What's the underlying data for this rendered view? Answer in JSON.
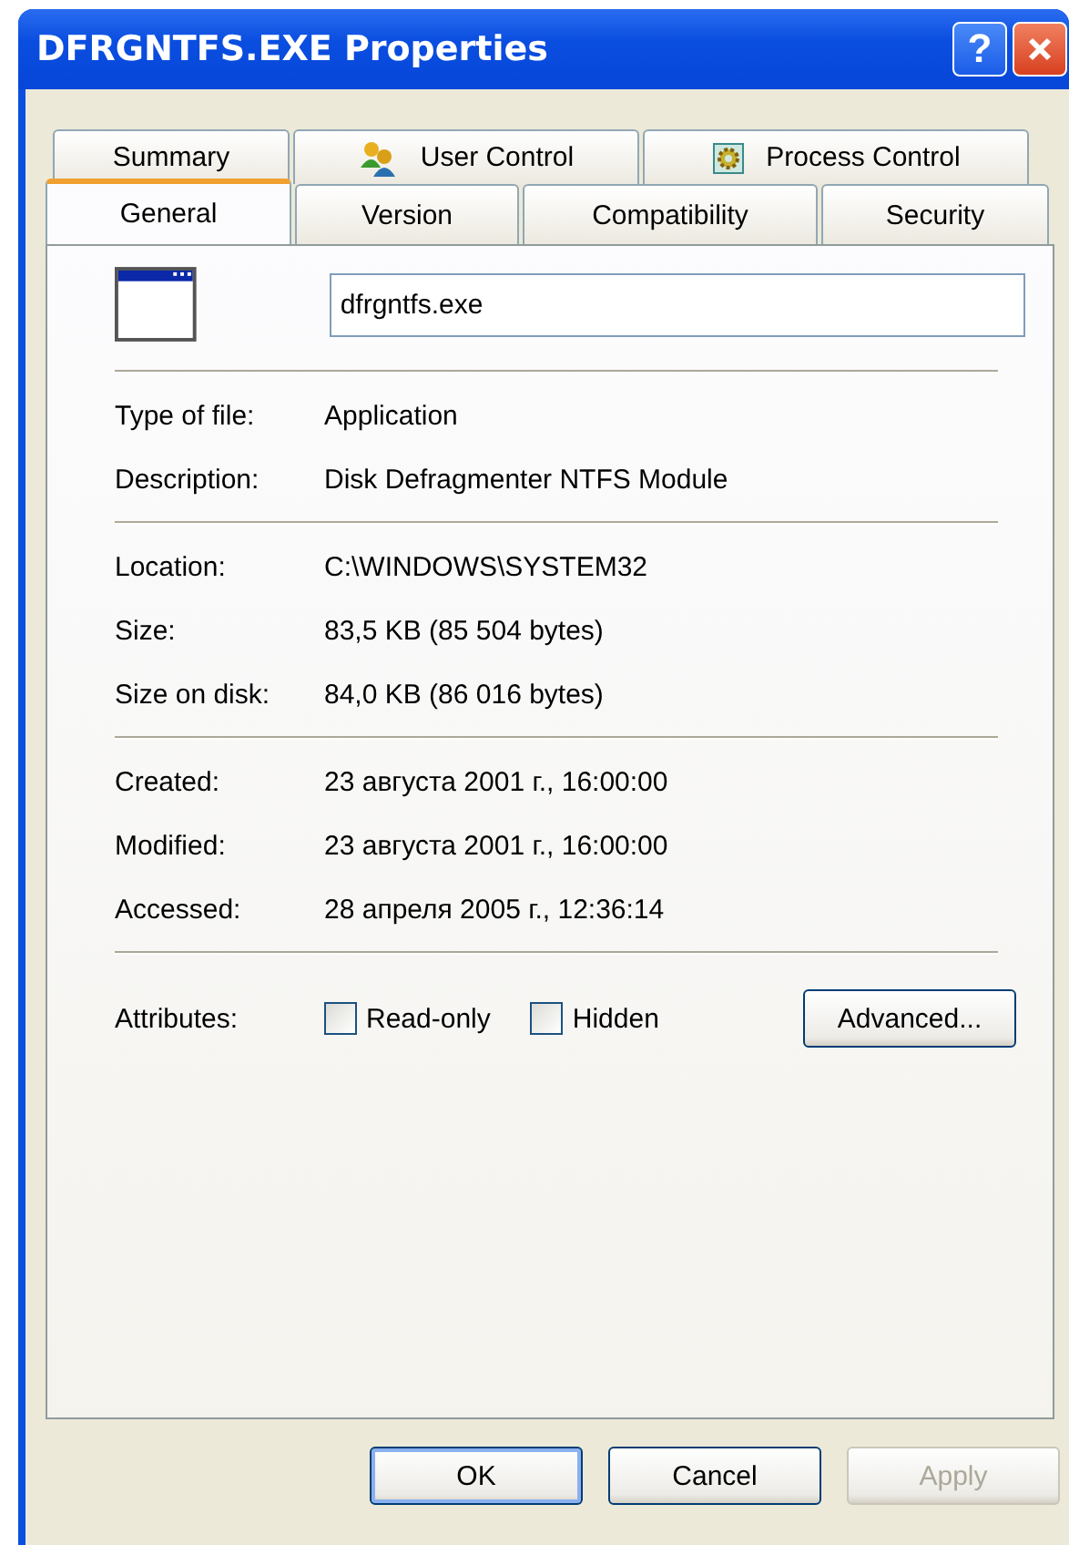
{
  "window": {
    "title": "DFRGNTFS.EXE Properties",
    "help_button": "?"
  },
  "tab_rows": [
    [
      {
        "label": "Summary",
        "selected": false,
        "kind": "plain"
      },
      {
        "label": "User Control",
        "selected": false,
        "kind": "users"
      },
      {
        "label": "Process Control",
        "selected": false,
        "kind": "gear"
      }
    ],
    [
      {
        "label": "General",
        "selected": true,
        "kind": "plain"
      },
      {
        "label": "Version",
        "selected": false,
        "kind": "plain"
      },
      {
        "label": "Compatibility",
        "selected": false,
        "kind": "plain"
      },
      {
        "label": "Security",
        "selected": false,
        "kind": "plain"
      }
    ]
  ],
  "file_name": "dfrgntfs.exe",
  "groups": [
    [
      {
        "label": "Type of file:",
        "value": "Application"
      },
      {
        "label": "Description:",
        "value": "Disk Defragmenter NTFS Module"
      }
    ],
    [
      {
        "label": "Location:",
        "value": "C:\\WINDOWS\\SYSTEM32"
      },
      {
        "label": "Size:",
        "value": "83,5 KB (85 504 bytes)"
      },
      {
        "label": "Size on disk:",
        "value": "84,0 KB (86 016 bytes)"
      }
    ],
    [
      {
        "label": "Created:",
        "value": "23 августа 2001 г., 16:00:00"
      },
      {
        "label": "Modified:",
        "value": "23 августа 2001 г., 16:00:00"
      },
      {
        "label": "Accessed:",
        "value": "28 апреля 2005 г., 12:36:14"
      }
    ]
  ],
  "attributes": {
    "label": "Attributes:",
    "checkboxes": [
      {
        "label": "Read-only",
        "checked": false
      },
      {
        "label": "Hidden",
        "checked": false
      }
    ],
    "button": "Advanced..."
  },
  "buttons": [
    {
      "label": "OK",
      "disabled": false,
      "default": true
    },
    {
      "label": "Cancel",
      "disabled": false,
      "default": false
    },
    {
      "label": "Apply",
      "disabled": true,
      "default": false
    }
  ]
}
